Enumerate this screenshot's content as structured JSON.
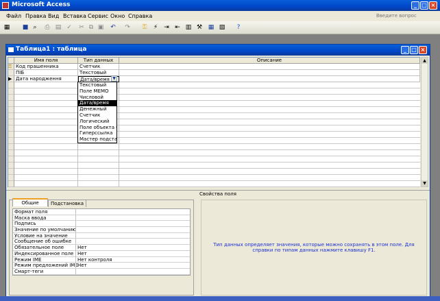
{
  "app": {
    "title": "Microsoft Access"
  },
  "menu": {
    "items": [
      "Файл",
      "Правка",
      "Вид",
      "Вставка",
      "Сервис",
      "Окно",
      "Справка"
    ],
    "ask_placeholder": "Введите вопрос"
  },
  "table": {
    "title": "Таблица1 : таблица",
    "headers": {
      "field": "Имя поля",
      "type": "Тип данных",
      "desc": "Описание"
    },
    "rows": [
      {
        "field": "Код прашенника",
        "type": "Счетчик",
        "key": true
      },
      {
        "field": "ПІБ",
        "type": "Текстовый"
      },
      {
        "field": "Дата народження",
        "type": "Дата/время",
        "current": true
      }
    ]
  },
  "dropdown": {
    "options": [
      "Текстовый",
      "Поле MEMO",
      "Числовой",
      "Дата/время",
      "Денежный",
      "Счетчик",
      "Логический",
      "Поле объекта OLE",
      "Гиперссылка",
      "Мастер подстановок..."
    ],
    "selected_index": 3
  },
  "properties": {
    "title": "Свойства поля",
    "tabs": [
      "Общие",
      "Подстановка"
    ],
    "rows": [
      {
        "name": "Формат поля",
        "value": ""
      },
      {
        "name": "Маска ввода",
        "value": ""
      },
      {
        "name": "Подпись",
        "value": ""
      },
      {
        "name": "Значение по умолчанию",
        "value": ""
      },
      {
        "name": "Условие на значение",
        "value": ""
      },
      {
        "name": "Сообщение об ошибке",
        "value": ""
      },
      {
        "name": "Обязательное поле",
        "value": "Нет"
      },
      {
        "name": "Индексированное поле",
        "value": "Нет"
      },
      {
        "name": "Режим IME",
        "value": "Нет контроля"
      },
      {
        "name": "Режим предложений IME",
        "value": "Нет"
      },
      {
        "name": "Смарт-теги",
        "value": ""
      }
    ],
    "help": "Тип данных определяет значения, которые можно сохранять в этом поле.  Для справки по типам данных нажмите клавишу F1."
  }
}
